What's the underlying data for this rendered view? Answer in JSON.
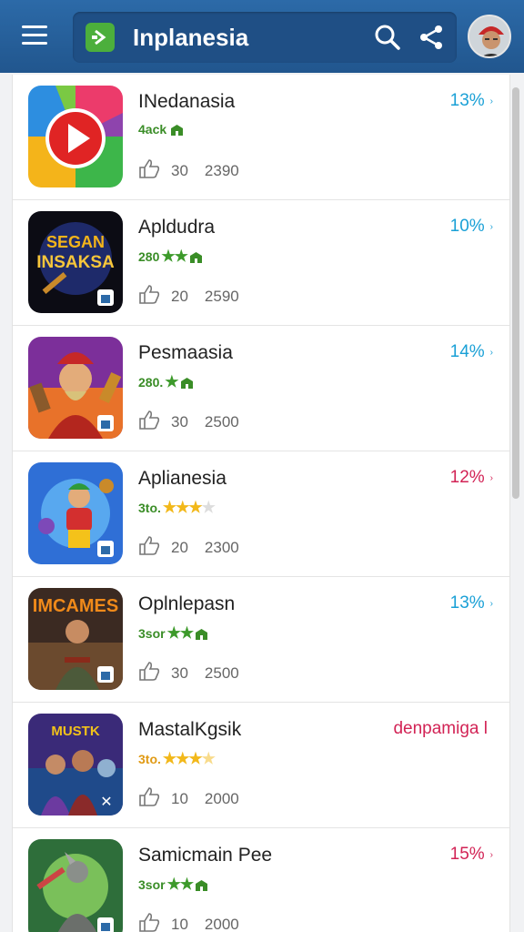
{
  "app": {
    "title": "Inplanesia"
  },
  "header": {
    "icons": [
      "menu-icon",
      "app-logo-icon",
      "search-icon",
      "share-icon"
    ]
  },
  "colors": {
    "header_bg": "#2c6aa8",
    "blue_badge": "#1aa0d6",
    "red_badge": "#d22355",
    "green_text": "#3a8d27",
    "gold_star": "#f2b81a"
  },
  "items": [
    {
      "name": "INedanasia",
      "sub": "4ack",
      "stars": "",
      "likes": "30",
      "downloads": "2390",
      "badge": "13%",
      "badge_color": "#1aa0d6",
      "arrow": "›"
    },
    {
      "name": "Apldudra",
      "sub": "280",
      "stars": "★★",
      "likes": "20",
      "downloads": "2590",
      "badge": "10%",
      "badge_color": "#1aa0d6",
      "arrow": "›"
    },
    {
      "name": "Pesmaasia",
      "sub": "280.",
      "stars": "★",
      "likes": "30",
      "downloads": "2500",
      "badge": "14%",
      "badge_color": "#1aa0d6",
      "arrow": "›"
    },
    {
      "name": "Aplianesia",
      "sub": "3to.",
      "stars": "★★★",
      "likes": "20",
      "downloads": "2300",
      "badge": "12%",
      "badge_color": "#d22355",
      "arrow": "›"
    },
    {
      "name": "Oplnlepasn",
      "sub": "3sor",
      "stars": "★★",
      "likes": "30",
      "downloads": "2500",
      "badge": "13%",
      "badge_color": "#1aa0d6",
      "arrow": "›"
    },
    {
      "name": "MastalKgsik",
      "sub": "3to.",
      "stars": "★★★",
      "likes": "10",
      "downloads": "2000",
      "badge": "denpamiga l",
      "badge_color": "#d22355",
      "arrow": ""
    },
    {
      "name": "Samicmain Pee",
      "sub": "3sor",
      "stars": "★★",
      "likes": "10",
      "downloads": "2000",
      "badge": "15%",
      "badge_color": "#d22355",
      "arrow": "›"
    }
  ]
}
